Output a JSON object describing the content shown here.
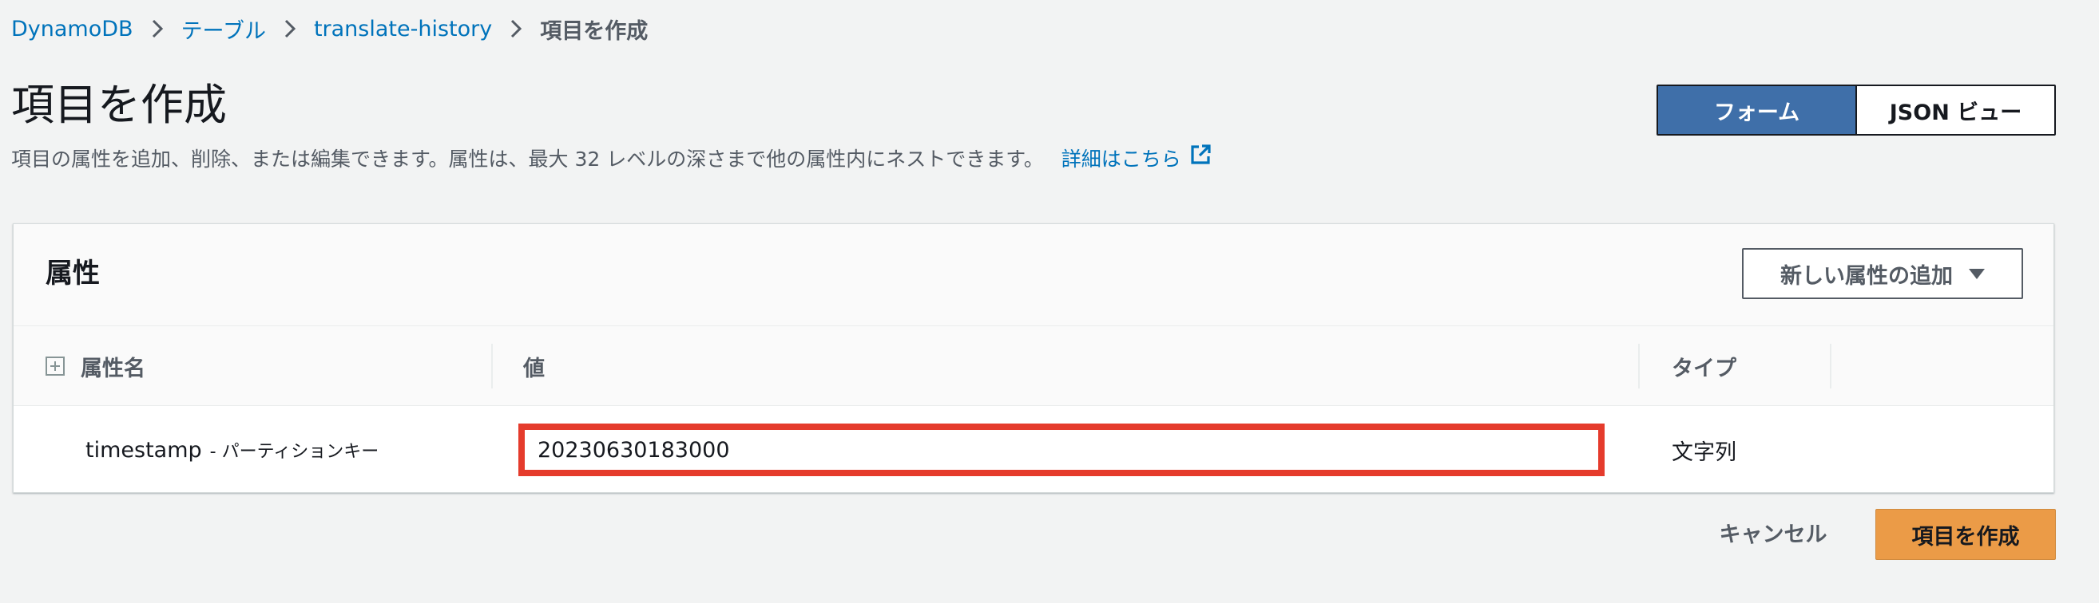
{
  "breadcrumb": {
    "items": [
      "DynamoDB",
      "テーブル",
      "translate-history"
    ],
    "current": "項目を作成"
  },
  "header": {
    "title": "項目を作成",
    "description": "項目の属性を追加、削除、または編集できます。属性は、最大 32 レベルの深さまで他の属性内にネストできます。",
    "learn_more": "詳細はこちら"
  },
  "view_toggle": {
    "options": [
      "フォーム",
      "JSON ビュー"
    ],
    "selected": "フォーム"
  },
  "attributes_panel": {
    "title": "属性",
    "add_button": "新しい属性の追加",
    "columns": [
      "属性名",
      "値",
      "タイプ"
    ],
    "rows": [
      {
        "name": "timestamp",
        "key_label": "- パーティションキー",
        "value": "20230630183000",
        "type": "文字列"
      }
    ]
  },
  "footer": {
    "cancel_label": "キャンセル",
    "create_label": "項目を作成"
  },
  "colors": {
    "link": "#0073bb",
    "toggle_active": "#3f6fa9",
    "primary_button": "#eb9b47",
    "highlight_border": "#e53b2c"
  },
  "icons": {
    "breadcrumb_separator": "chevron-right-icon",
    "external_link": "external-link-icon",
    "dropdown": "caret-down-icon",
    "expand_all": "plus-square-icon"
  }
}
